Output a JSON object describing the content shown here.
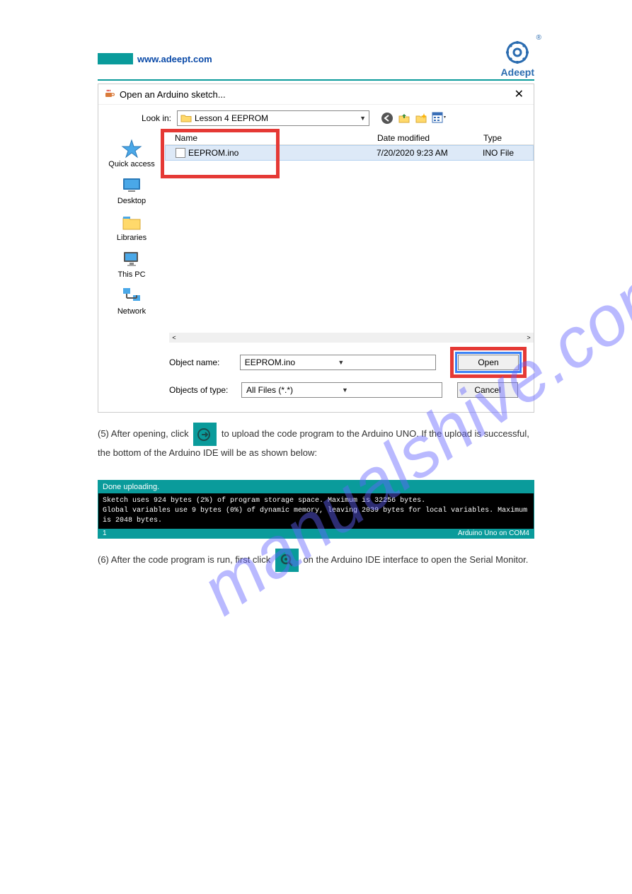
{
  "header": {
    "url": "www.adeept.com",
    "logo_text": "Adeept"
  },
  "dialog": {
    "title": "Open an Arduino sketch...",
    "lookin_label": "Look in:",
    "lookin_value": "Lesson 4 EEPROM",
    "columns": {
      "name": "Name",
      "date": "Date modified",
      "type": "Type"
    },
    "file": {
      "name": "EEPROM.ino",
      "date": "7/20/2020 9:23 AM",
      "type": "INO File"
    },
    "sidebar": {
      "quick": "Quick access",
      "desktop": "Desktop",
      "libraries": "Libraries",
      "thispc": "This PC",
      "network": "Network"
    },
    "footer": {
      "objname_label": "Object name:",
      "objname_value": "EEPROM.ino",
      "objtype_label": "Objects of type:",
      "objtype_value": "All Files (*.*)",
      "open": "Open",
      "cancel": "Cancel"
    }
  },
  "instruction1_a": "(5) After opening, click ",
  "instruction1_b": " to upload the code program to the Arduino UNO. If the upload is successful, the bottom of the Arduino IDE will be as shown below:",
  "console": {
    "status": "Done uploading.",
    "line1": "Sketch uses 924 bytes (2%) of program storage space. Maximum is 32256 bytes.",
    "line2": "Global variables use 9 bytes (0%) of dynamic memory, leaving 2039 bytes for local variables. Maximum is 2048 bytes.",
    "barleft": "1",
    "barright": "Arduino Uno on COM4"
  },
  "instruction2_a": "(6) After the code program is run, first click ",
  "instruction2_b": " on the Arduino IDE interface to open the Serial Monitor.",
  "watermark": "manualshive.com"
}
